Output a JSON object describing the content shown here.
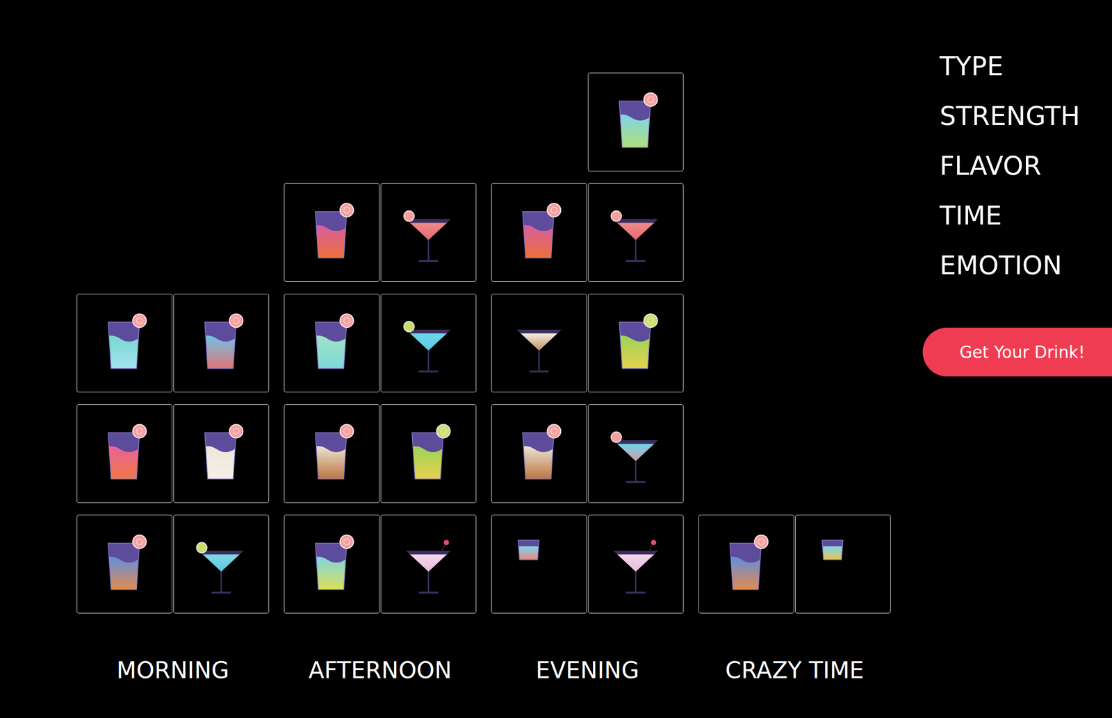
{
  "columns": [
    {
      "label": "MORNING",
      "rows": [
        {
          "cards": [
            {
              "kind": "highball",
              "color": "#7ad6d0",
              "color2": "#a9e6f5",
              "garnish": "#f5a0a0"
            },
            {
              "kind": "highball",
              "color": "#6fc3e6",
              "color2": "#f06a6a",
              "garnish": "#f5a0a0"
            }
          ]
        },
        {
          "cards": [
            {
              "kind": "highball",
              "color": "#e8639a",
              "color2": "#f27a3a",
              "garnish": "#f5a0a0"
            },
            {
              "kind": "highball",
              "color": "#ece6dc",
              "color2": "#f6f1e8",
              "garnish": "#f5a0a0"
            }
          ]
        },
        {
          "cards": [
            {
              "kind": "highball",
              "color": "#5f8fe0",
              "color2": "#f48a3a",
              "garnish": "#f5a0a0"
            },
            {
              "kind": "martini",
              "color": "#7fd8e6",
              "color2": "#4fc2e0",
              "garnish": "#c7e06a"
            }
          ]
        }
      ]
    },
    {
      "label": "AFTERNOON",
      "rows": [
        {
          "cards": [
            {
              "kind": "highball",
              "color": "#d65fa0",
              "color2": "#f0722f",
              "garnish": "#f5a0a0"
            },
            {
              "kind": "martini",
              "color": "#f08a8a",
              "color2": "#e0606a",
              "garnish": "#f5a0a0"
            }
          ]
        },
        {
          "cards": [
            {
              "kind": "highball",
              "color": "#9fe3c4",
              "color2": "#7ad8e0",
              "garnish": "#f5a0a0"
            },
            {
              "kind": "martini",
              "color": "#6fd6ea",
              "color2": "#4fc8e0",
              "garnish": "#c7e06a"
            }
          ]
        },
        {
          "cards": [
            {
              "kind": "highball",
              "color": "#ece3d3",
              "color2": "#b5652d",
              "garnish": "#f5a0a0"
            },
            {
              "kind": "highball",
              "color": "#9bd45a",
              "color2": "#f2d04a",
              "garnish": "#c7e06a"
            }
          ]
        },
        {
          "cards": [
            {
              "kind": "highball",
              "color": "#7fd6e0",
              "color2": "#e8e04a",
              "garnish": "#f5a0a0"
            },
            {
              "kind": "martini",
              "color": "#f3d6ea",
              "color2": "#e8b8d8",
              "garnish": "#e0506a"
            }
          ]
        }
      ]
    },
    {
      "label": "EVENING",
      "rows": [
        {
          "cards": [
            {
              "kind": "highball",
              "color": "#7fd6e6",
              "color2": "#b7e06a",
              "garnish": "#f5a0a0"
            }
          ]
        },
        {
          "cards": [
            {
              "kind": "highball",
              "color": "#d65fa0",
              "color2": "#f0722f",
              "garnish": "#f5a0a0"
            },
            {
              "kind": "martini",
              "color": "#f08a8a",
              "color2": "#e0606a",
              "garnish": "#f5a0a0"
            }
          ]
        },
        {
          "cards": [
            {
              "kind": "martini",
              "color": "#f4ece0",
              "color2": "#b5753a",
              "garnish": null
            },
            {
              "kind": "highball",
              "color": "#9bd45a",
              "color2": "#f2d04a",
              "garnish": "#c7e06a"
            }
          ]
        },
        {
          "cards": [
            {
              "kind": "highball",
              "color": "#ece3d3",
              "color2": "#b5652d",
              "garnish": "#f5a0a0"
            },
            {
              "kind": "martini",
              "color": "#6fd6ea",
              "color2": "#f08a9a",
              "garnish": "#f5a0a0"
            }
          ]
        },
        {
          "cards": [
            {
              "kind": "rocks",
              "color": "#7fd6e6",
              "color2": "#f08080",
              "garnish": null
            },
            {
              "kind": "martini",
              "color": "#f3d6ea",
              "color2": "#e8b8d8",
              "garnish": "#e0506a"
            }
          ]
        }
      ]
    },
    {
      "label": "CRAZY TIME",
      "rows": [
        {
          "cards": [
            {
              "kind": "highball",
              "color": "#5f8fe0",
              "color2": "#f48a3a",
              "garnish": "#f5a0a0"
            },
            {
              "kind": "rocks",
              "color": "#7fd6e6",
              "color2": "#f0c050",
              "garnish": null
            }
          ]
        }
      ]
    }
  ],
  "filters": [
    "TYPE",
    "STRENGTH",
    "FLAVOR",
    "TIME",
    "EMOTION"
  ],
  "button": "Get Your Drink!"
}
